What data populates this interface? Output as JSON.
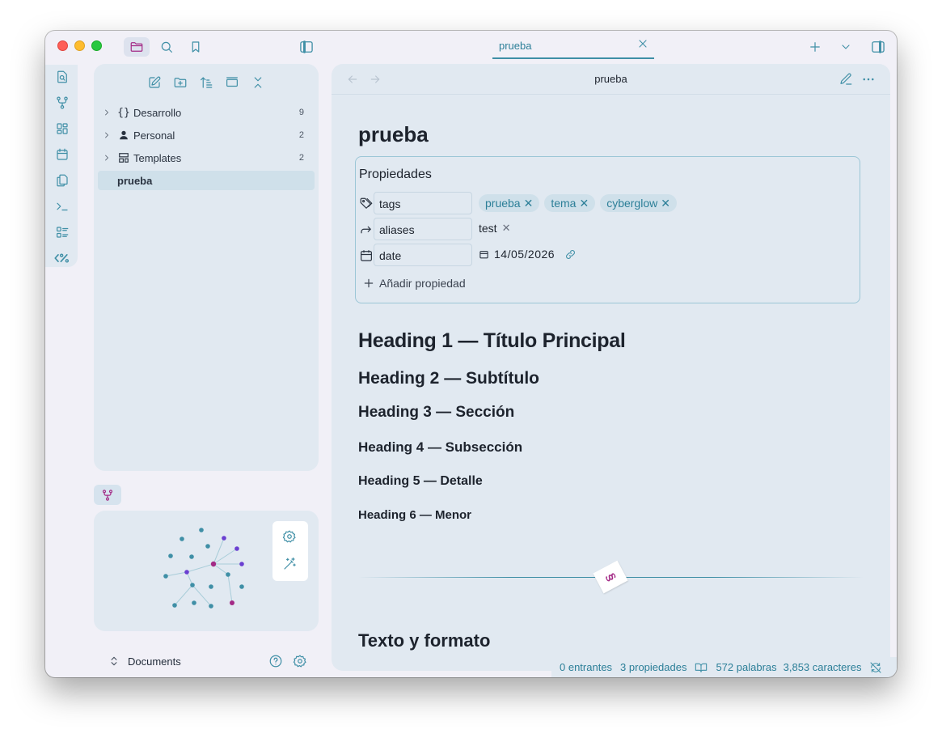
{
  "tab": {
    "title": "prueba"
  },
  "explorer": {
    "items": [
      {
        "label": "Desarrollo",
        "count": "9",
        "icon": "braces-icon"
      },
      {
        "label": "Personal",
        "count": "2",
        "icon": "user-icon"
      },
      {
        "label": "Templates",
        "count": "2",
        "icon": "layout-template-icon"
      },
      {
        "label": "prueba"
      }
    ]
  },
  "vault": {
    "name": "Documents"
  },
  "editor": {
    "header_title": "prueba",
    "note_title": "prueba",
    "properties": {
      "heading": "Propiedades",
      "tags_key": "tags",
      "tags": [
        "prueba",
        "tema",
        "cyberglow"
      ],
      "aliases_key": "aliases",
      "aliases": [
        "test"
      ],
      "date_key": "date",
      "date_value": "14/05/2026",
      "add_label": "Añadir propiedad"
    },
    "headings": [
      "Heading 1 — Título Principal",
      "Heading 2 — Subtítulo",
      "Heading 3 — Sección",
      "Heading 4 — Subsección",
      "Heading 5 — Detalle",
      "Heading 6 — Menor"
    ],
    "divider_symbol": "§",
    "section_heading": "Texto y formato"
  },
  "status": {
    "backlinks": "0 entrantes",
    "properties": "3 propiedades",
    "words": "572 palabras",
    "chars": "3,853 caracteres"
  },
  "colors": {
    "accent": "#3f8fa6",
    "tag_bg": "#cfe0ea",
    "pane_bg": "#e1e9f1",
    "divider_badge": "#a32a86"
  }
}
